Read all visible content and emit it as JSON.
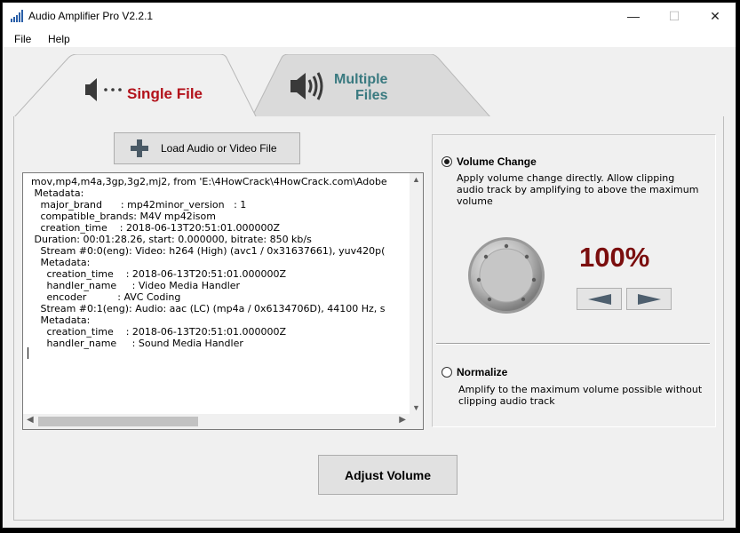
{
  "window": {
    "title": "Audio Amplifier Pro V2.2.1",
    "controls": {
      "minimize": "—",
      "maximize": "☐",
      "close": "✕"
    }
  },
  "menu": [
    "File",
    "Help"
  ],
  "tabs": {
    "single": "Single File",
    "multiple_line1": "Multiple",
    "multiple_line2": "Files",
    "active": "single"
  },
  "load_button": {
    "label": "Load Audio or Video File",
    "icon": "plus-icon"
  },
  "log_lines": [
    "mov,mp4,m4a,3gp,3g2,mj2, from 'E:\\4HowCrack\\4HowCrack.com\\Adobe",
    " Metadata:",
    "   major_brand      : mp42minor_version   : 1",
    "   compatible_brands: M4V mp42isom",
    "   creation_time    : 2018-06-13T20:51:01.000000Z",
    " Duration: 00:01:28.26, start: 0.000000, bitrate: 850 kb/s",
    "   Stream #0:0(eng): Video: h264 (High) (avc1 / 0x31637661), yuv420p(",
    "   Metadata:",
    "     creation_time    : 2018-06-13T20:51:01.000000Z",
    "     handler_name     : Video Media Handler",
    "     encoder          : AVC Coding",
    "   Stream #0:1(eng): Audio: aac (LC) (mp4a / 0x6134706D), 44100 Hz, s",
    "   Metadata:",
    "     creation_time    : 2018-06-13T20:51:01.000000Z",
    "     handler_name     : Sound Media Handler"
  ],
  "volume_change": {
    "title": "Volume Change",
    "description": "Apply volume change directly. Allow clipping audio track by amplifying to above the maximum volume",
    "selected": true,
    "percent": "100%"
  },
  "normalize": {
    "title": "Normalize",
    "description": "Amplify to the maximum volume possible without clipping audio track",
    "selected": false
  },
  "adjust_button": "Adjust Volume",
  "colors": {
    "single_tab_label": "#b3121b",
    "multiple_tab_label": "#3a7a80",
    "percent": "#7b0e0e"
  }
}
